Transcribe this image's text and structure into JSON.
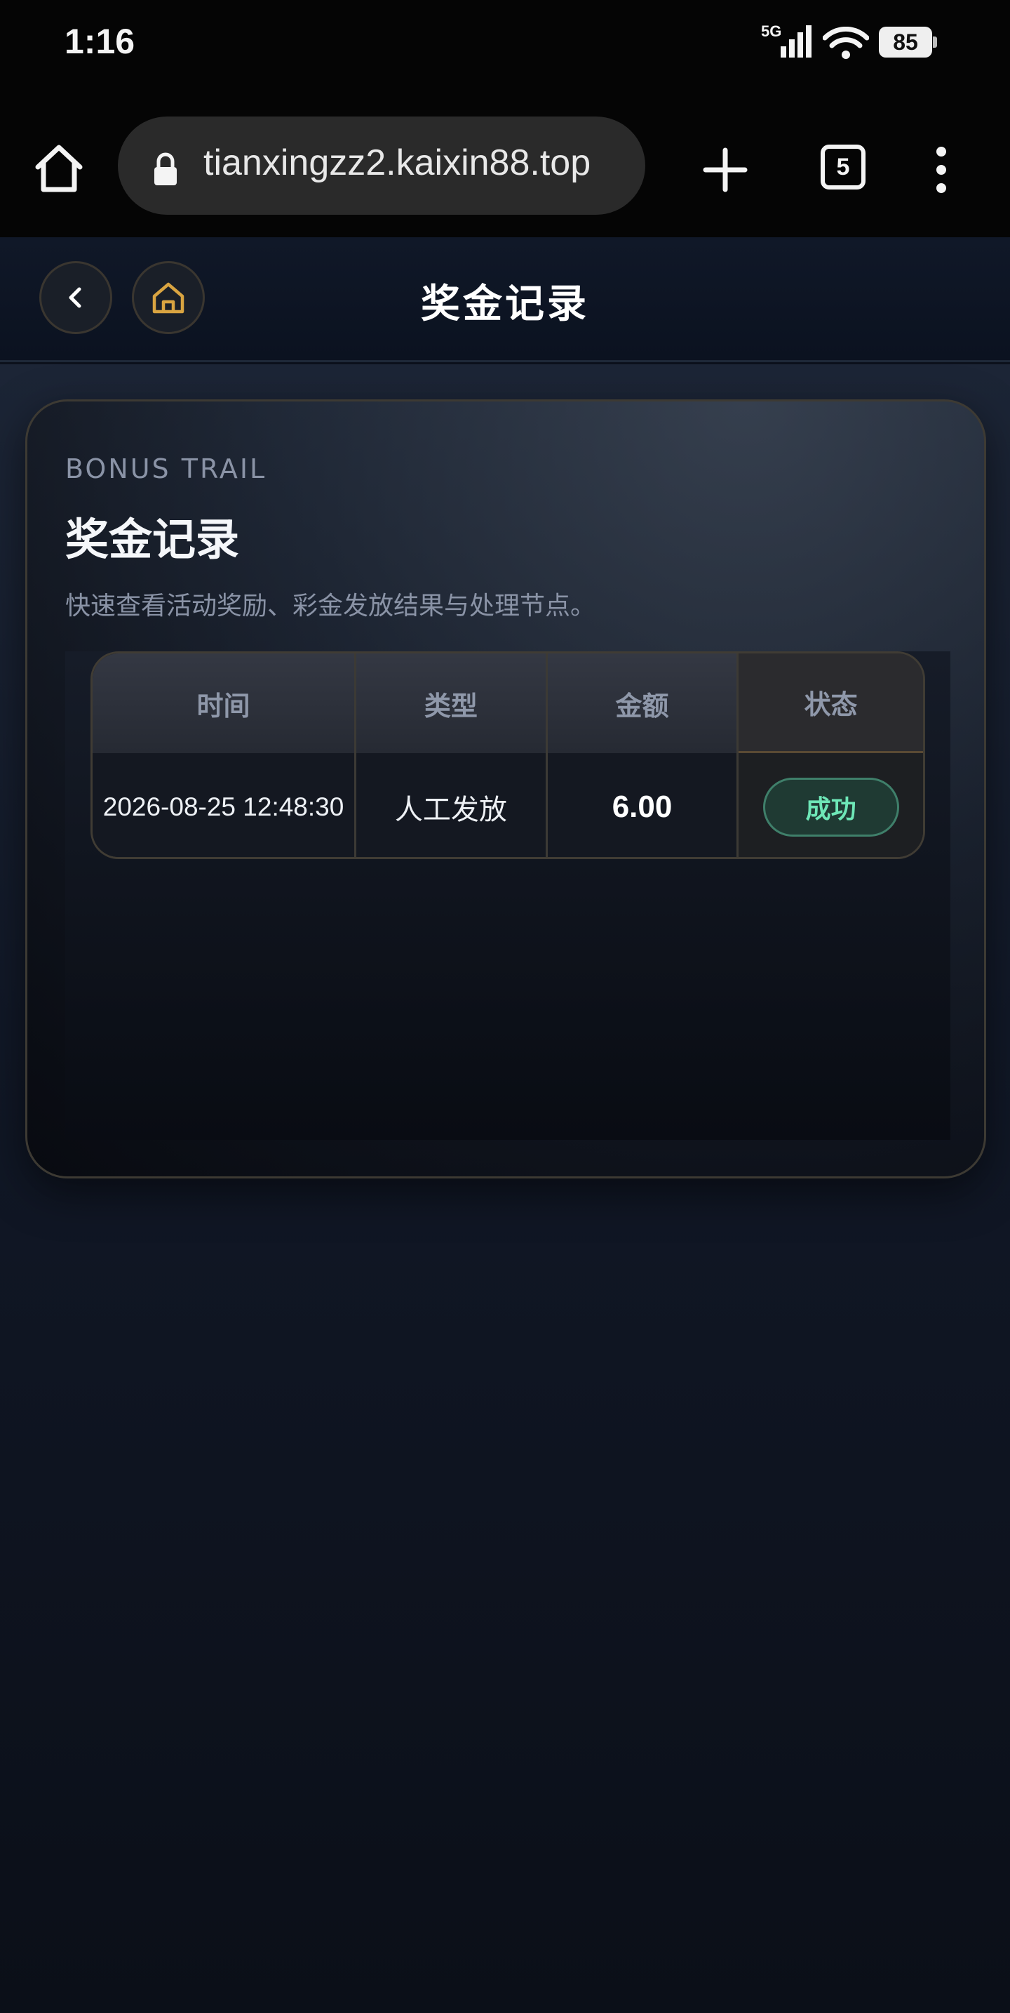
{
  "status_bar": {
    "time": "1:16",
    "network": "5G",
    "battery": "85"
  },
  "browser": {
    "url": "tianxingzz2.kaixin88.top",
    "tab_count": "5",
    "icons": [
      "home-icon",
      "lock-icon",
      "plus-icon",
      "tabs-icon",
      "more-vert-icon"
    ]
  },
  "header": {
    "title": "奖金记录"
  },
  "card": {
    "eyebrow": "BONUS TRAIL",
    "title": "奖金记录",
    "description": "快速查看活动奖励、彩金发放结果与处理节点。"
  },
  "table": {
    "columns": [
      "时间",
      "类型",
      "金额",
      "状态"
    ],
    "rows": [
      {
        "time": "2026-08-25 12:48:30",
        "type": "人工发放",
        "amount": "6.00",
        "status": "成功"
      }
    ]
  },
  "colors": {
    "accent_gold": "#d9a441",
    "success_text": "#6ee7b7",
    "success_bg": "#1f3a33"
  }
}
